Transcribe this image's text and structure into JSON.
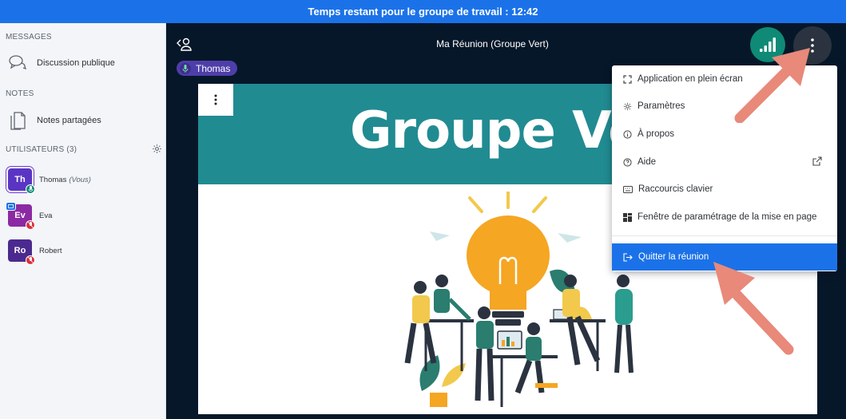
{
  "banner": {
    "text": "Temps restant pour le groupe de travail : 12:42"
  },
  "sidebar": {
    "messages_title": "MESSAGES",
    "public_chat": "Discussion publique",
    "notes_title": "NOTES",
    "shared_notes": "Notes partagées",
    "users_title": "UTILISATEURS (3)",
    "users": [
      {
        "initials": "Th",
        "name": "Thomas",
        "suffix": "(Vous)",
        "color": "#5a35c4"
      },
      {
        "initials": "Ev",
        "name": "Eva",
        "suffix": "",
        "color": "#8b2aa3"
      },
      {
        "initials": "Ro",
        "name": "Robert",
        "suffix": "",
        "color": "#4b2a8f"
      }
    ]
  },
  "header": {
    "meeting_title": "Ma Réunion (Groupe Vert)",
    "talker": "Thomas"
  },
  "slide": {
    "title": "Groupe Vert"
  },
  "menu": {
    "items": [
      {
        "label": "Application en plein écran",
        "icon": "fullscreen-icon"
      },
      {
        "label": "Paramètres",
        "icon": "gear-icon"
      },
      {
        "label": "À propos",
        "icon": "info-icon"
      },
      {
        "label": "Aide",
        "icon": "help-icon"
      },
      {
        "label": "Raccourcis clavier",
        "icon": "keyboard-icon"
      },
      {
        "label": "Fenêtre de paramétrage de la mise en page",
        "icon": "layout-icon"
      },
      {
        "label": "Quitter la réunion",
        "icon": "logout-icon"
      }
    ]
  },
  "colors": {
    "banner": "#1b72e8",
    "background": "#06172a",
    "slide_band": "#218b92",
    "connection": "#0f8a76",
    "arrow": "#e8897a"
  }
}
